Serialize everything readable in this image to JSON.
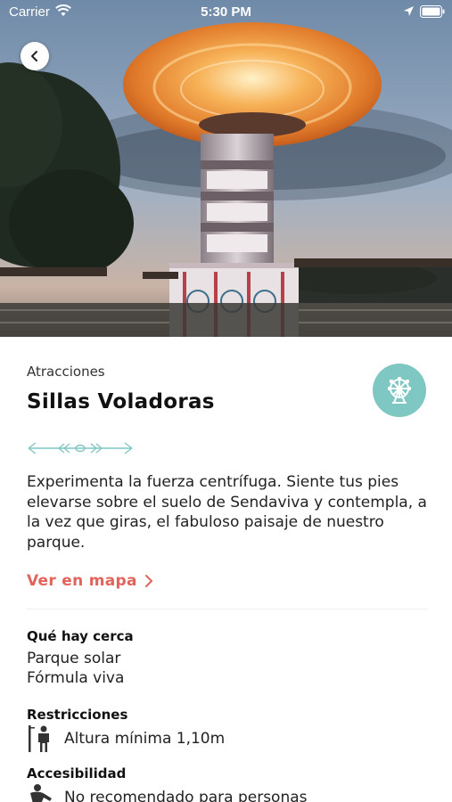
{
  "status_bar": {
    "carrier": "Carrier",
    "time": "5:30 PM"
  },
  "hero": {
    "description_icons": [
      "wifi-icon",
      "location-arrow-icon",
      "battery-icon",
      "back-chevron-icon"
    ]
  },
  "attraction": {
    "category": "Atracciones",
    "title": "Sillas Voladoras",
    "badge_icon": "ferris-wheel-icon",
    "description": "Experimenta la fuerza centrífuga. Siente tus pies elevarse sobre el suelo de Sendaviva y contempla, a la vez que giras, el fabuloso paisaje de nuestro parque.",
    "map_link": "Ver en mapa"
  },
  "nearby": {
    "title": "Qué hay cerca",
    "items": [
      "Parque solar",
      "Fórmula viva"
    ]
  },
  "restrictions": {
    "title": "Restricciones",
    "items": [
      {
        "icon": "height-measure-icon",
        "text": "Altura mínima 1,10m"
      }
    ]
  },
  "accessibility": {
    "title": "Accesibilidad",
    "items": [
      {
        "icon": "person-reduced-mobility-icon",
        "text": "No recomendado para personas"
      }
    ]
  },
  "colors": {
    "accent": "#e0645a",
    "badge": "#7fc7c3"
  }
}
